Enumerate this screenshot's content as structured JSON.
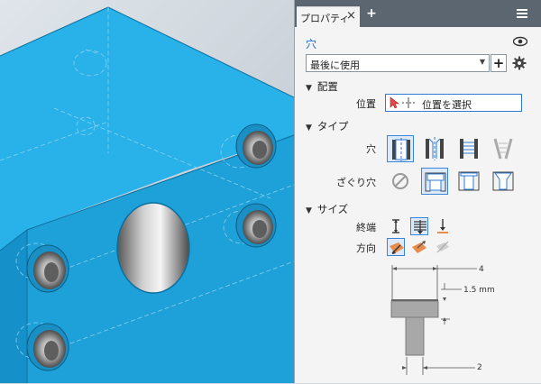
{
  "panel": {
    "tab_label": "プロパティ",
    "close_glyph": "×",
    "add_glyph": "+",
    "feature_name": "穴",
    "preset_value": "最後に使用",
    "preset_arrow": "▼",
    "preset_add": "+",
    "sections": {
      "placement": {
        "title": "配置",
        "position_label": "位置",
        "position_value": "位置を選択"
      },
      "type": {
        "title": "タイプ",
        "hole_label": "穴",
        "hole_options": [
          "simple-hole-icon",
          "clearance-hole-icon",
          "tapped-hole-icon",
          "taper-tapped-hole-icon"
        ],
        "hole_selected": 0,
        "seat_label": "ざぐり穴",
        "seat_options": [
          "none-icon",
          "counterbore-icon",
          "spotface-icon",
          "countersink-icon"
        ],
        "seat_selected": 1
      },
      "size": {
        "title": "サイズ",
        "termination_label": "終端",
        "termination_options": [
          "distance-icon",
          "through-all-icon",
          "to-icon"
        ],
        "termination_selected": 1,
        "direction_label": "方向",
        "direction_options": [
          "default-direction-icon",
          "flipped-direction-icon",
          "symmetric-direction-icon"
        ],
        "direction_selected": 0
      }
    },
    "preview": {
      "counterbore_diameter": "4",
      "counterbore_depth": "1.5 mm",
      "hole_diameter": "2"
    }
  },
  "colors": {
    "part_front": "#1ea0d8",
    "part_top": "#29b2ea",
    "part_side": "#1690c8",
    "accent": "#2f7bd6",
    "direction_active": "#e88c4c"
  }
}
